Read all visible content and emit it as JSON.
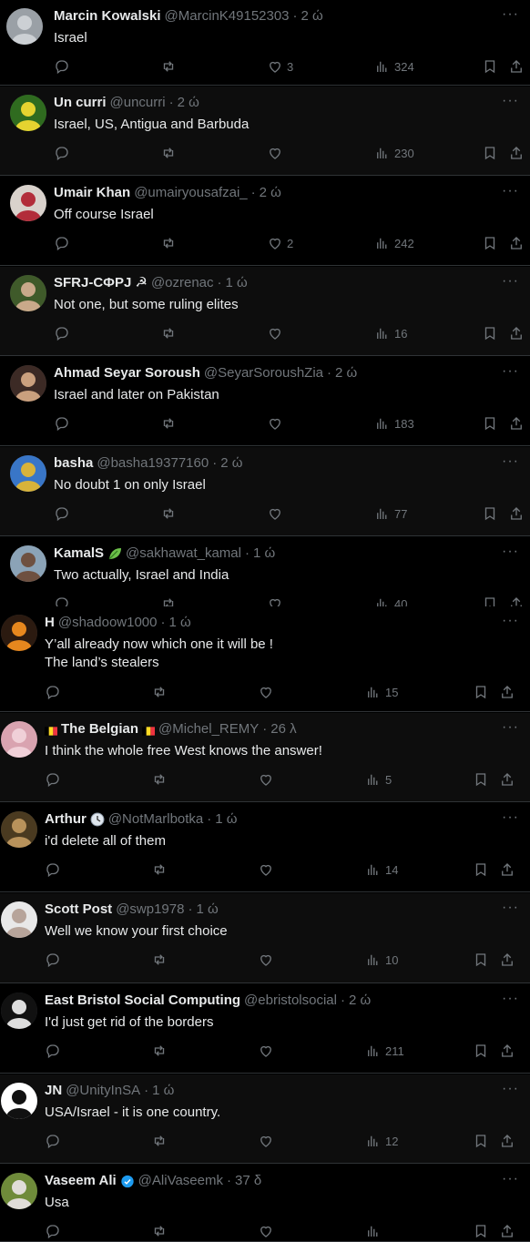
{
  "tweets": [
    {
      "name": "Marcin Kowalski",
      "handle": "@MarcinK49152303",
      "time": "2 ώ",
      "text": "Israel",
      "likes": "3",
      "views": "324"
    },
    {
      "name": "Un curri",
      "handle": "@uncurri",
      "time": "2 ώ",
      "text": "Israel, US, Antigua and Barbuda",
      "likes": "",
      "views": "230"
    },
    {
      "name": "Umair Khan",
      "handle": "@umairyousafzai_",
      "time": "2 ώ",
      "text": "Off course Israel",
      "likes": "2",
      "views": "242"
    },
    {
      "name": "SFRJ-СФРЈ ☭",
      "handle": "@ozrenac",
      "time": "1 ώ",
      "text": "Not one, but some ruling elites",
      "likes": "",
      "views": "16"
    },
    {
      "name": "Ahmad Seyar Soroush",
      "handle": "@SeyarSoroushZia",
      "time": "2 ώ",
      "text": "Israel and later on Pakistan",
      "likes": "",
      "views": "183"
    },
    {
      "name": "basha",
      "handle": "@basha19377160",
      "time": "2 ώ",
      "text": "No doubt 1 on only Israel",
      "likes": "",
      "views": "77"
    },
    {
      "name": "KamalS",
      "handle": "@sakhawat_kamal",
      "time": "1 ώ",
      "text": "Two actually, Israel and India",
      "likes": "",
      "views": "40"
    },
    {
      "name": "H",
      "handle": "@shadoow1000",
      "time": "1 ώ",
      "text": "Y’all already now which one it will be !\nThe land’s stealers",
      "likes": "",
      "views": "15"
    },
    {
      "name": "The Belgian",
      "handle": "@Michel_REMY",
      "time": "26 λ",
      "text": "I think the whole free West knows the answer!",
      "likes": "",
      "views": "5"
    },
    {
      "name": "Arthur",
      "handle": "@NotMarlbotka",
      "time": "1 ώ",
      "text": "i'd delete all of them",
      "likes": "",
      "views": "14"
    },
    {
      "name": "Scott Post",
      "handle": "@swp1978",
      "time": "1 ώ",
      "text": "Well we know your first choice",
      "likes": "",
      "views": "10"
    },
    {
      "name": "East Bristol Social Computing",
      "handle": "@ebristolsocial",
      "time": "2 ώ",
      "text": "I'd just get rid of the borders",
      "likes": "",
      "views": "211"
    },
    {
      "name": "JN",
      "handle": "@UnityInSA",
      "time": "1 ώ",
      "text": "USA/Israel - it is one country.",
      "likes": "",
      "views": "12"
    },
    {
      "name": "Vaseem Ali",
      "handle": "@AliVaseemk",
      "time": "37 δ",
      "text": "Usa",
      "likes": "",
      "views": ""
    }
  ],
  "separator": "·",
  "more_label": "···",
  "colors": {
    "background": "#000000",
    "text": "#e7e9ea",
    "muted": "#71767b",
    "border": "#2f3336",
    "verified": "#1d9bf0"
  },
  "icons": [
    "reply-icon",
    "retweet-icon",
    "like-icon",
    "views-icon",
    "bookmark-icon",
    "share-icon",
    "more-icon",
    "verified-icon"
  ]
}
